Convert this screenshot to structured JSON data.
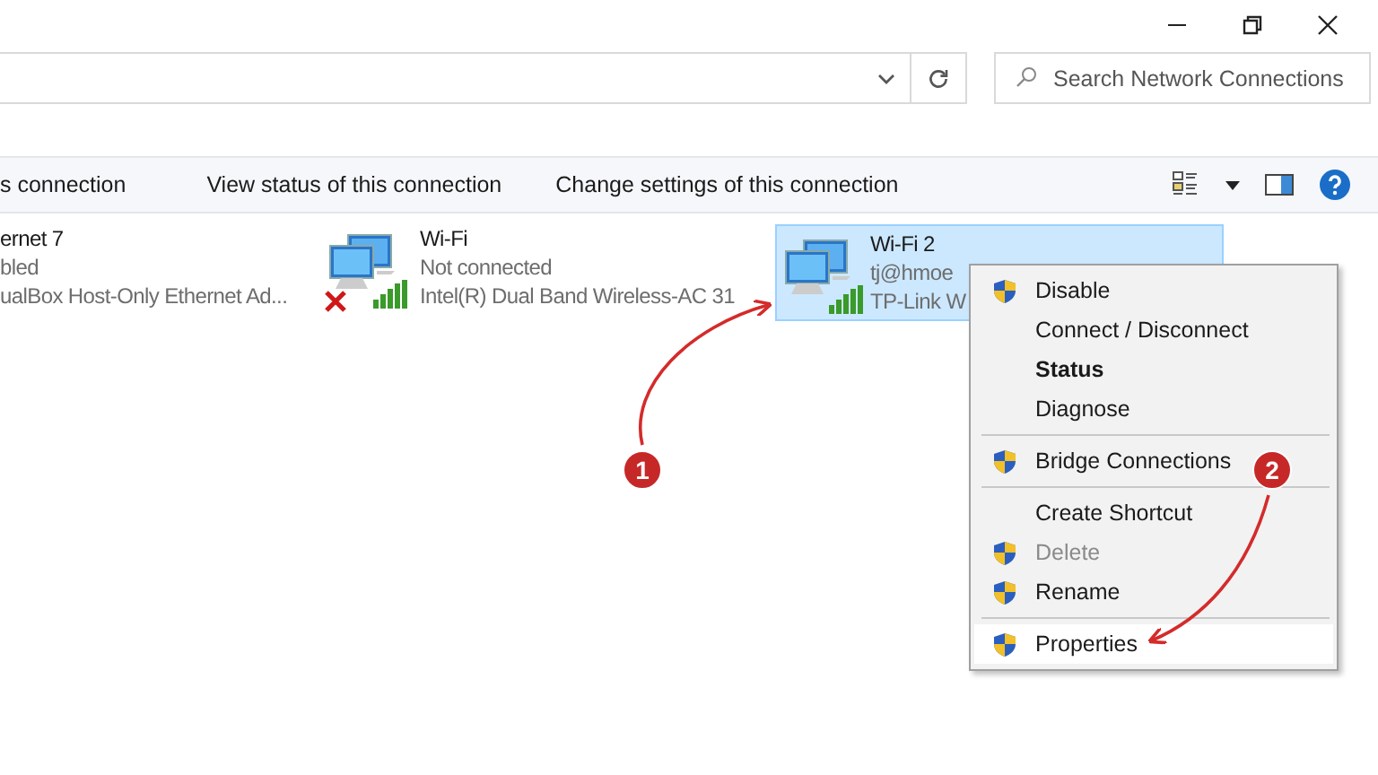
{
  "search": {
    "placeholder": "Search Network Connections"
  },
  "command_bar": {
    "items": [
      "s connection",
      "View status of this connection",
      "Change settings of this connection"
    ]
  },
  "connections": [
    {
      "kind": "cut",
      "name": "ernet 7",
      "status": "bled",
      "device": "ualBox Host-Only Ethernet Ad...",
      "selected": false,
      "connected": true
    },
    {
      "kind": "wireless",
      "name": "Wi-Fi",
      "status": "Not connected",
      "device": "Intel(R) Dual Band Wireless-AC 31",
      "selected": false,
      "connected": false
    },
    {
      "kind": "wireless",
      "name": "Wi-Fi 2",
      "status": "tj@hmoe",
      "device": "TP-Link W",
      "selected": true,
      "connected": true
    }
  ],
  "context_menu": {
    "items": [
      {
        "kind": "item",
        "label": "Disable",
        "shield": true,
        "default": false,
        "disabled": false,
        "selected": false
      },
      {
        "kind": "item",
        "label": "Connect / Disconnect",
        "shield": false,
        "default": false,
        "disabled": false,
        "selected": false
      },
      {
        "kind": "item",
        "label": "Status",
        "shield": false,
        "default": true,
        "disabled": false,
        "selected": false
      },
      {
        "kind": "item",
        "label": "Diagnose",
        "shield": false,
        "default": false,
        "disabled": false,
        "selected": false
      },
      {
        "kind": "separator"
      },
      {
        "kind": "item",
        "label": "Bridge Connections",
        "shield": true,
        "default": false,
        "disabled": false,
        "selected": false
      },
      {
        "kind": "separator"
      },
      {
        "kind": "item",
        "label": "Create Shortcut",
        "shield": false,
        "default": false,
        "disabled": false,
        "selected": false
      },
      {
        "kind": "item",
        "label": "Delete",
        "shield": true,
        "default": false,
        "disabled": true,
        "selected": false
      },
      {
        "kind": "item",
        "label": "Rename",
        "shield": true,
        "default": false,
        "disabled": false,
        "selected": false
      },
      {
        "kind": "separator"
      },
      {
        "kind": "item",
        "label": "Properties",
        "shield": true,
        "default": false,
        "disabled": false,
        "selected": true
      }
    ]
  },
  "annotations": [
    {
      "label": "1"
    },
    {
      "label": "2"
    }
  ]
}
